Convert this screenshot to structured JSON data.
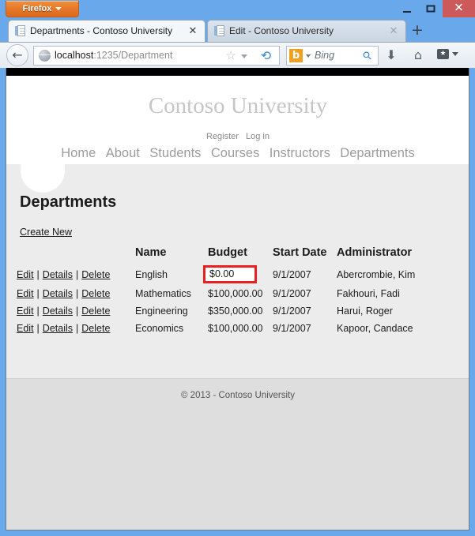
{
  "window": {
    "firefox_menu_label": "Firefox",
    "minimize_label": "Minimize",
    "maximize_label": "Maximize",
    "close_label": "✕"
  },
  "tabs": [
    {
      "title": "Departments - Contoso University",
      "close": "✕",
      "active": true
    },
    {
      "title": "Edit - Contoso University",
      "close": "✕",
      "active": false
    }
  ],
  "new_tab_label": "+",
  "navbar": {
    "back_arrow": "←",
    "url_host": "localhost",
    "url_path": ":1235/Department",
    "star": "☆",
    "reload": "⟳",
    "search_engine_glyph": "b",
    "search_placeholder": "Bing",
    "search_go": "⚲",
    "download": "⬇",
    "home": "⌂",
    "bookmarks": "★"
  },
  "site": {
    "brand": "Contoso University",
    "account_links": [
      {
        "label": "Register"
      },
      {
        "label": "Log in"
      }
    ],
    "nav": [
      {
        "label": "Home"
      },
      {
        "label": "About"
      },
      {
        "label": "Students"
      },
      {
        "label": "Courses"
      },
      {
        "label": "Instructors"
      },
      {
        "label": "Departments"
      }
    ],
    "footer": "© 2013 - Contoso University"
  },
  "page": {
    "title": "Departments",
    "create_new": "Create New",
    "table": {
      "headers": {
        "actions": "",
        "name": "Name",
        "budget": "Budget",
        "start_date": "Start Date",
        "administrator": "Administrator"
      },
      "row_actions": {
        "edit": "Edit",
        "details": "Details",
        "delete": "Delete",
        "separator": "|"
      },
      "rows": [
        {
          "name": "English",
          "budget": "$0.00",
          "start_date": "9/1/2007",
          "administrator": "Abercrombie, Kim",
          "highlighted": true
        },
        {
          "name": "Mathematics",
          "budget": "$100,000.00",
          "start_date": "9/1/2007",
          "administrator": "Fakhouri, Fadi",
          "highlighted": false
        },
        {
          "name": "Engineering",
          "budget": "$350,000.00",
          "start_date": "9/1/2007",
          "administrator": "Harui, Roger",
          "highlighted": false
        },
        {
          "name": "Economics",
          "budget": "$100,000.00",
          "start_date": "9/1/2007",
          "administrator": "Kapoor, Candace",
          "highlighted": false
        }
      ]
    }
  },
  "colors": {
    "accent_blue": "#6aa8ec",
    "firefox_orange": "#e4772a",
    "highlight_red": "#ea2020",
    "close_red": "#cc5a5a",
    "page_bg": "#ececec",
    "footer_bg": "#dedede"
  }
}
